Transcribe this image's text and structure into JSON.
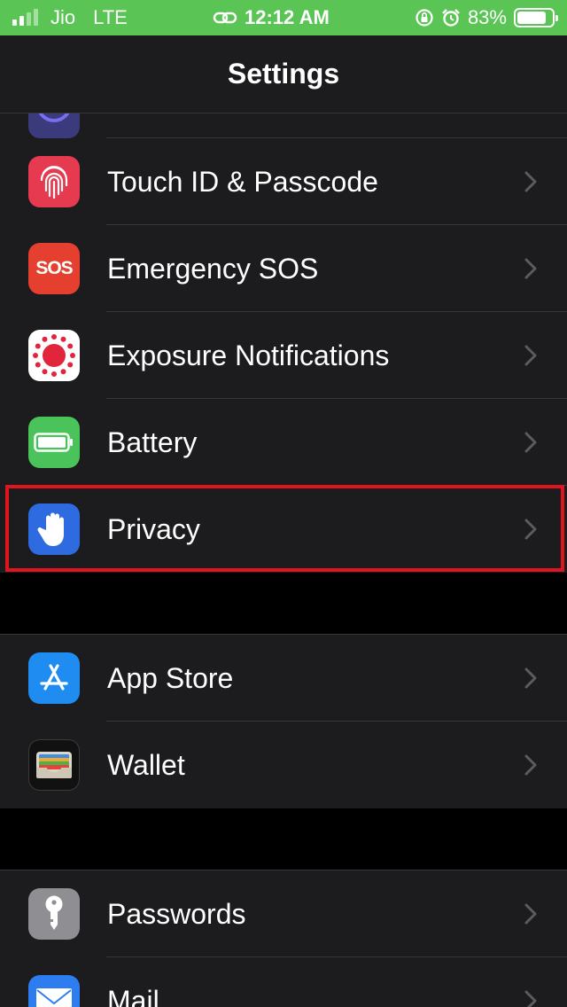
{
  "status_bar": {
    "carrier": "Jio",
    "network": "LTE",
    "time": "12:12 AM",
    "battery_percent": "83%",
    "battery_level": 0.83,
    "bg_color": "#5ac455"
  },
  "nav": {
    "title": "Settings"
  },
  "groups": [
    {
      "items": [
        {
          "label": "Touch ID & Passcode",
          "icon": "fingerprint-icon",
          "icon_color": "#e53a50"
        },
        {
          "label": "Emergency SOS",
          "icon": "sos-icon",
          "icon_text": "SOS",
          "icon_color": "#e5402f"
        },
        {
          "label": "Exposure Notifications",
          "icon": "exposure-notification-icon",
          "icon_color": "#ffffff"
        },
        {
          "label": "Battery",
          "icon": "battery-icon",
          "icon_color": "#4ac35a"
        },
        {
          "label": "Privacy",
          "icon": "hand-icon",
          "icon_color": "#2f6be0",
          "highlighted": true
        }
      ]
    },
    {
      "items": [
        {
          "label": "App Store",
          "icon": "app-store-icon",
          "icon_color": "#1e8cf0"
        },
        {
          "label": "Wallet",
          "icon": "wallet-icon",
          "icon_color": "#111111"
        }
      ]
    },
    {
      "items": [
        {
          "label": "Passwords",
          "icon": "key-icon",
          "icon_color": "#8e8e93"
        },
        {
          "label": "Mail",
          "icon": "mail-icon",
          "icon_color": "#2d7df0"
        }
      ]
    }
  ],
  "highlight_color": "#e0141e"
}
